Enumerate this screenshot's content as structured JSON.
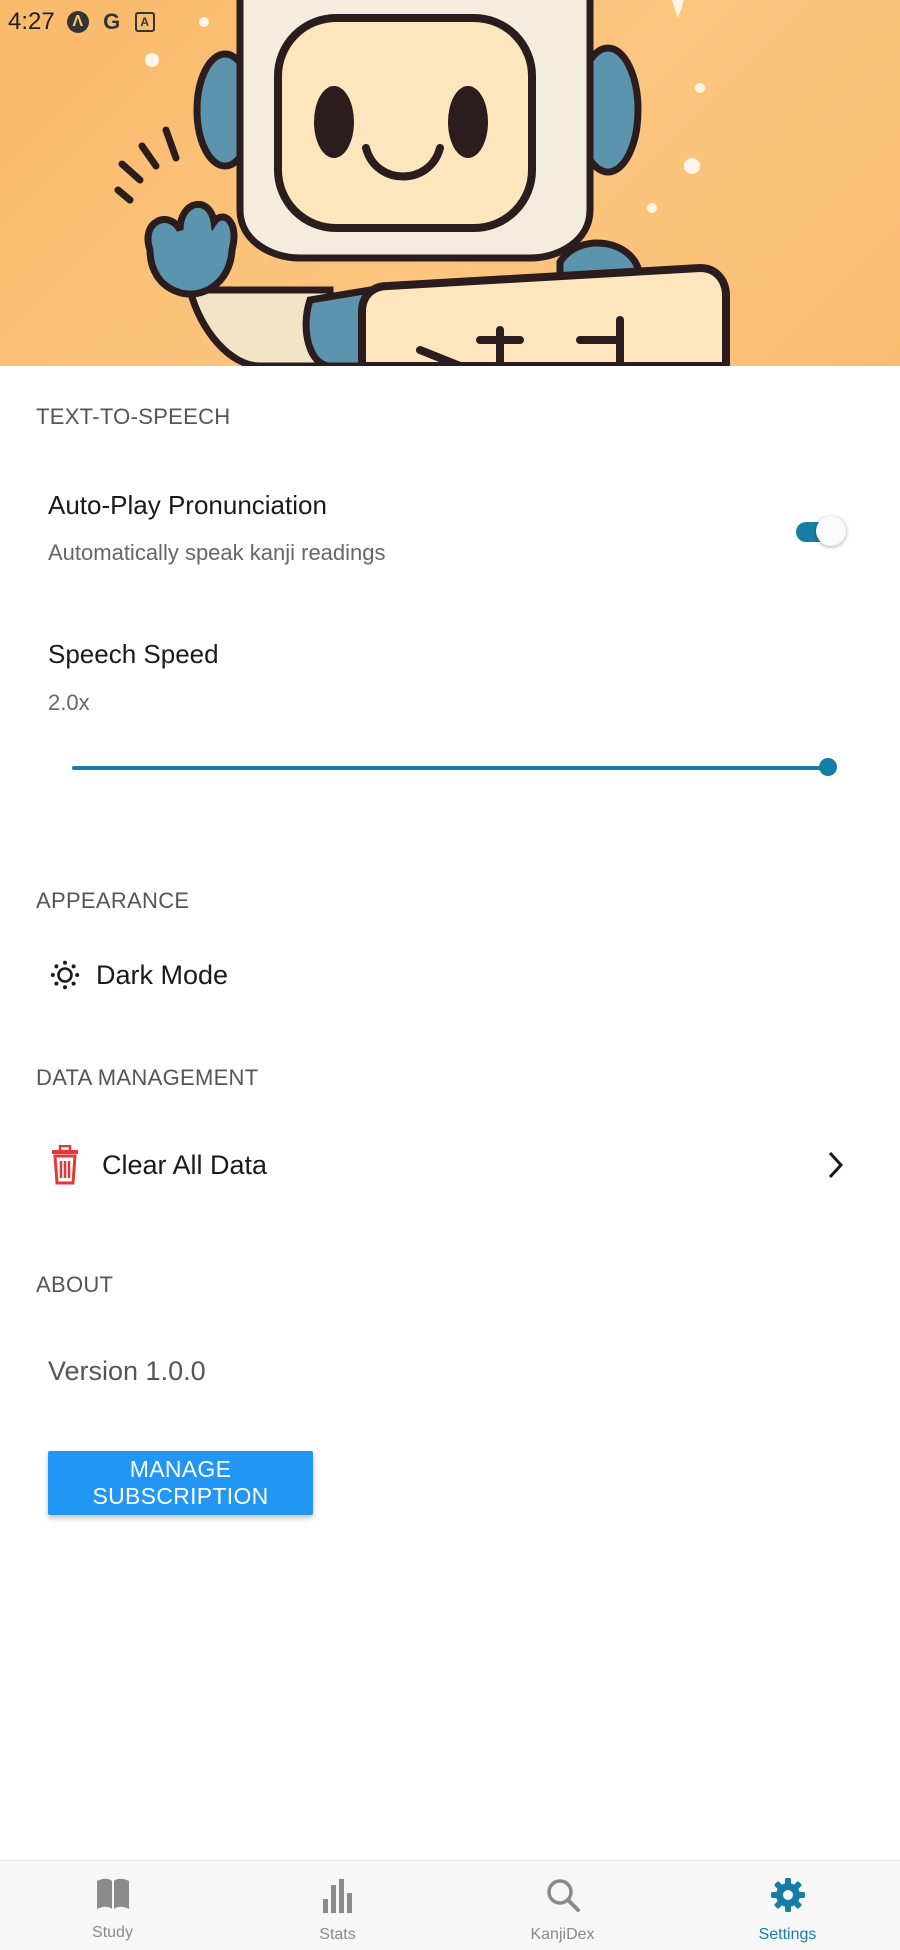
{
  "status_bar": {
    "time": "4:27",
    "icons": [
      "app-a-icon",
      "google-icon",
      "app-square-a-icon"
    ]
  },
  "hero": {
    "illustration": "robot-mascot-waving-with-sign"
  },
  "sections": {
    "tts": {
      "header": "TEXT-TO-SPEECH",
      "autoplay": {
        "title": "Auto-Play Pronunciation",
        "subtitle": "Automatically speak kanji readings",
        "enabled": true
      },
      "speed": {
        "title": "Speech Speed",
        "value_label": "2.0x",
        "value": 2.0,
        "fraction": 1.0
      }
    },
    "appearance": {
      "header": "APPEARANCE",
      "dark_mode": {
        "label": "Dark Mode",
        "icon": "brightness-icon"
      }
    },
    "data": {
      "header": "DATA MANAGEMENT",
      "clear": {
        "label": "Clear All Data",
        "icon": "trash-icon",
        "chevron": "chevron-right-icon"
      }
    },
    "about": {
      "header": "ABOUT",
      "version": "Version 1.0.0",
      "manage_button": "MANAGE SUBSCRIPTION"
    }
  },
  "bottom_nav": {
    "items": [
      {
        "label": "Study",
        "icon": "book-icon",
        "active": false
      },
      {
        "label": "Stats",
        "icon": "bar-chart-icon",
        "active": false
      },
      {
        "label": "KanjiDex",
        "icon": "search-icon",
        "active": false
      },
      {
        "label": "Settings",
        "icon": "gear-icon",
        "active": true
      }
    ]
  },
  "colors": {
    "accent": "#167ea6",
    "button": "#2196f3",
    "danger": "#e53935",
    "hero_bg": "#f9bd72"
  }
}
